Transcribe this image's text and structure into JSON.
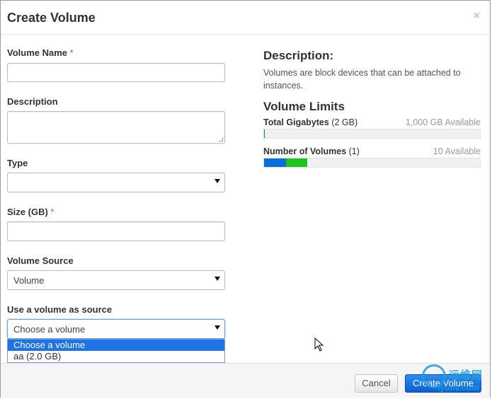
{
  "modal": {
    "title": "Create Volume",
    "close": "×"
  },
  "form": {
    "volume_name": {
      "label": "Volume Name",
      "required": "*",
      "value": ""
    },
    "description": {
      "label": "Description",
      "value": ""
    },
    "type": {
      "label": "Type",
      "selected": ""
    },
    "size": {
      "label": "Size (GB)",
      "required": "*",
      "value": ""
    },
    "volume_source": {
      "label": "Volume Source",
      "selected": "Volume"
    },
    "use_volume": {
      "label": "Use a volume as source",
      "selected": "Choose a volume",
      "options": [
        "Choose a volume",
        "aa (2.0 GB)"
      ]
    }
  },
  "info": {
    "description_heading": "Description:",
    "description_text": "Volumes are block devices that can be attached to instances.",
    "limits_heading": "Volume Limits",
    "limits": [
      {
        "name": "Total Gigabytes",
        "used": "(2 GB)",
        "available": "1,000 GB Available",
        "fill_fraction": 0.002
      },
      {
        "name": "Number of Volumes",
        "used": "(1)",
        "available": "10 Available",
        "fill_fraction": 0.1,
        "projected_fraction": 0.2
      }
    ]
  },
  "footer": {
    "cancel": "Cancel",
    "create": "Create Volume"
  },
  "watermark": {
    "text": "运维网",
    "sub": "iyunv.com"
  },
  "colors": {
    "primary": "#0b5fd0",
    "dropdown_selected": "#1e73e8",
    "bar_used": "#0a6fd8",
    "bar_projected": "#1ec41e",
    "required": "#3a87ad"
  }
}
